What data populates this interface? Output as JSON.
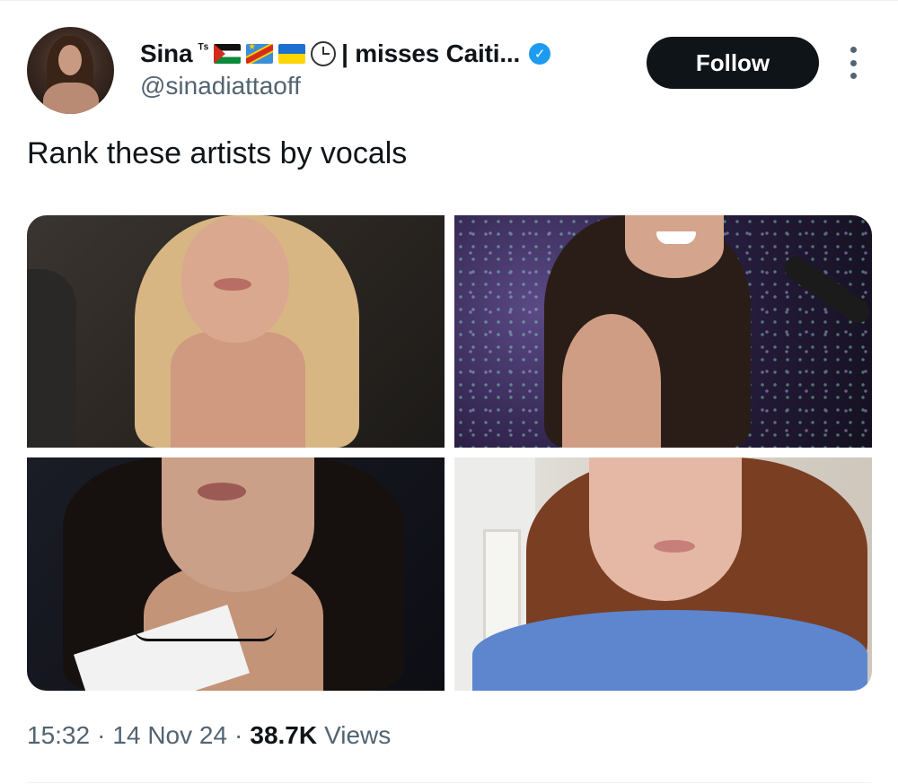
{
  "author": {
    "name": "Sina",
    "name_superscript": "ᵀˢ",
    "name_suffix": "| misses Caiti...",
    "handle": "@sinadiattaoff",
    "icons": [
      "palestine-flag-icon",
      "dr-congo-flag-icon",
      "ukraine-flag-icon",
      "clock-icon",
      "verified-badge-icon"
    ]
  },
  "actions": {
    "follow_label": "Follow",
    "more_icon": "more-vertical-icon"
  },
  "tweet": {
    "text": "Rank these artists by vocals"
  },
  "media": {
    "count": 4,
    "layout": "2x2 grid"
  },
  "meta": {
    "time": "15:32",
    "sep1": "·",
    "date": "14 Nov 24",
    "sep2": "·",
    "views_count": "38.7K",
    "views_label": "Views"
  },
  "colors": {
    "text_primary": "#0f1419",
    "text_secondary": "#536471",
    "verified_blue": "#1d9bf0",
    "follow_bg": "#0f1419",
    "follow_text": "#ffffff"
  }
}
